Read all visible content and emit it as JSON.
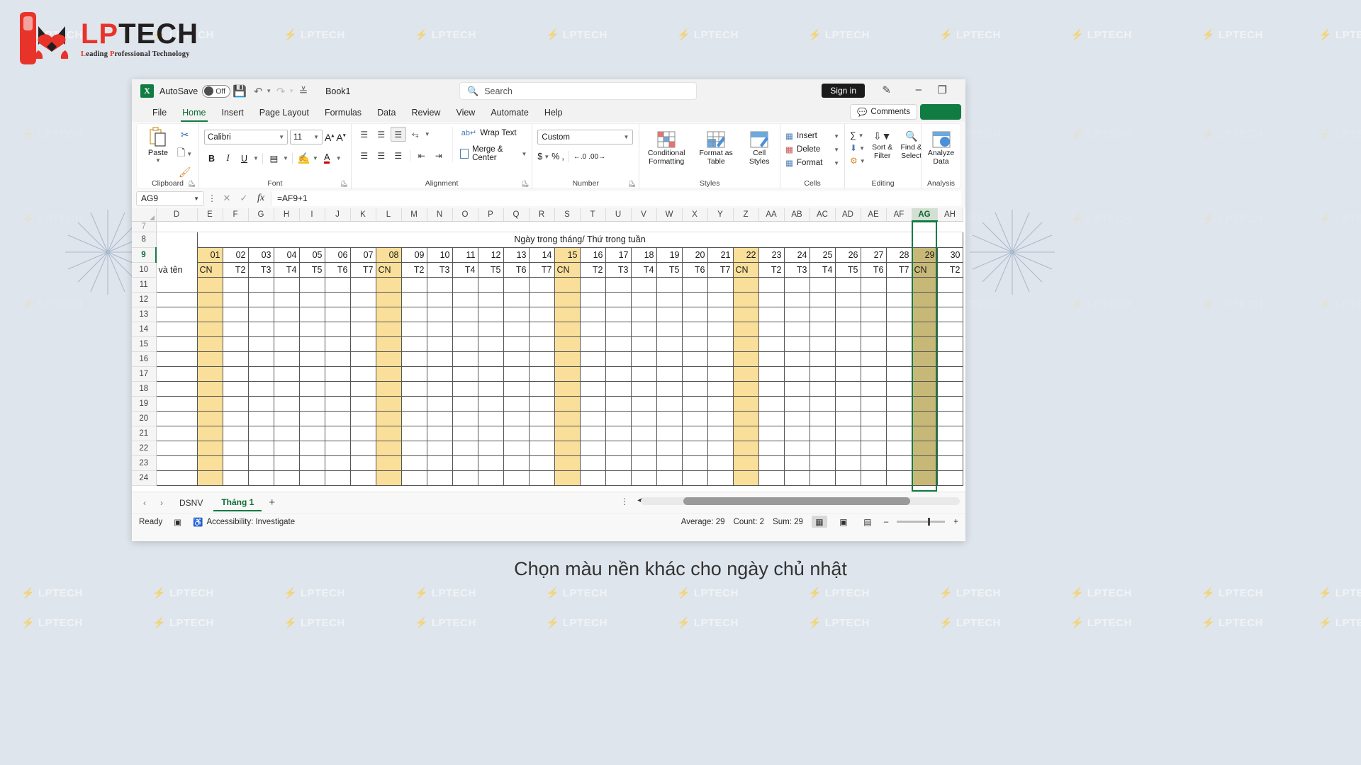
{
  "brand": {
    "name_lp": "LP",
    "name_tech": "TECH",
    "tagline_parts": [
      "L",
      "eading ",
      "P",
      "rofessional Technology"
    ],
    "watermark_text": "LPTECH",
    "accent_red": "#e8332a",
    "accent_dark": "#231f20"
  },
  "caption": "Chọn màu nền khác cho ngày chủ nhật",
  "titlebar": {
    "app_icon": "excel-icon",
    "autosave_label": "AutoSave",
    "autosave_state": "Off",
    "save_icon": "save-icon",
    "undo_icon": "undo-icon",
    "redo_icon": "redo-icon",
    "customize_icon": "customize-quick-access-icon",
    "document_title": "Book1",
    "search_placeholder": "Search",
    "search_icon": "search-icon",
    "sign_in_label": "Sign in",
    "pen_icon": "pen-icon",
    "minimize_label": "–",
    "restore_label": "❐"
  },
  "ribbon_tabs": [
    {
      "label": "File",
      "active": false
    },
    {
      "label": "Home",
      "active": true
    },
    {
      "label": "Insert",
      "active": false
    },
    {
      "label": "Page Layout",
      "active": false
    },
    {
      "label": "Formulas",
      "active": false
    },
    {
      "label": "Data",
      "active": false
    },
    {
      "label": "Review",
      "active": false
    },
    {
      "label": "View",
      "active": false
    },
    {
      "label": "Automate",
      "active": false
    },
    {
      "label": "Help",
      "active": false
    }
  ],
  "ribbon_right": {
    "comments_label": "Comments",
    "comment_icon": "comment-icon",
    "share_label": ""
  },
  "ribbon": {
    "clipboard": {
      "group_label": "Clipboard",
      "paste_label": "Paste",
      "cut_icon": "scissors-icon",
      "copy_icon": "copy-icon",
      "format_painter_icon": "format-painter-icon",
      "dialog_launcher": "dialog-launcher-icon"
    },
    "font": {
      "group_label": "Font",
      "font_name": "Calibri",
      "font_size": "11",
      "grow_font": "A",
      "shrink_font": "A",
      "bold": "B",
      "italic": "I",
      "underline": "U",
      "borders_icon": "borders-icon",
      "fill_color_icon": "fill-color-icon",
      "font_color_icon": "font-color-icon",
      "dialog_launcher": "dialog-launcher-icon"
    },
    "alignment": {
      "group_label": "Alignment",
      "wrap_text_label": "Wrap Text",
      "merge_center_label": "Merge & Center",
      "align_top_icon": "align-top-icon",
      "align_middle_icon": "align-middle-icon",
      "align_bottom_icon": "align-bottom-icon",
      "orientation_icon": "orientation-icon",
      "align_left_icon": "align-left-icon",
      "align_center_icon": "align-center-icon",
      "align_right_icon": "align-right-icon",
      "decrease_indent_icon": "decrease-indent-icon",
      "increase_indent_icon": "increase-indent-icon",
      "dialog_launcher": "dialog-launcher-icon"
    },
    "number": {
      "group_label": "Number",
      "format_value": "Custom",
      "currency": "$",
      "percent": "%",
      "comma": ",",
      "increase_decimal": ".00",
      "decrease_decimal": ".0",
      "dialog_launcher": "dialog-launcher-icon"
    },
    "styles": {
      "group_label": "Styles",
      "conditional_formatting": "Conditional Formatting",
      "format_as_table": "Format as Table",
      "cell_styles": "Cell Styles"
    },
    "cells": {
      "group_label": "Cells",
      "insert_label": "Insert",
      "delete_label": "Delete",
      "format_label": "Format"
    },
    "editing": {
      "group_label": "Editing",
      "autosum_icon": "autosum-icon",
      "fill_icon": "fill-down-icon",
      "clear_icon": "clear-icon",
      "sort_filter_label": "Sort & Filter",
      "find_select_label": "Find & Select"
    },
    "analysis": {
      "group_label": "Analysis",
      "analyze_data_label": "Analyze Data"
    }
  },
  "formula_bar": {
    "name_box": "AG9",
    "cancel_icon": "cancel-icon",
    "enter_icon": "enter-icon",
    "fx_icon": "insert-function-icon",
    "formula": "=AF9+1"
  },
  "sheet": {
    "columns": [
      "D",
      "E",
      "F",
      "G",
      "H",
      "I",
      "J",
      "K",
      "L",
      "M",
      "N",
      "O",
      "P",
      "Q",
      "R",
      "S",
      "T",
      "U",
      "V",
      "W",
      "X",
      "Y",
      "Z",
      "AA",
      "AB",
      "AC",
      "AD",
      "AE",
      "AF",
      "AG",
      "AH"
    ],
    "selected_column": "AG",
    "rows": [
      7,
      8,
      9,
      10,
      11,
      12,
      13,
      14,
      15,
      16,
      17,
      18,
      19,
      20,
      21,
      22,
      23,
      24
    ],
    "selected_row": 9,
    "merged_title": "Ngày trong tháng/ Thứ trong tuần",
    "label_cell": "và tên",
    "day_numbers": [
      "01",
      "02",
      "03",
      "04",
      "05",
      "06",
      "07",
      "08",
      "09",
      "10",
      "11",
      "12",
      "13",
      "14",
      "15",
      "16",
      "17",
      "18",
      "19",
      "20",
      "21",
      "22",
      "23",
      "24",
      "25",
      "26",
      "27",
      "28",
      "29",
      "30"
    ],
    "weekdays": [
      "CN",
      "T2",
      "T3",
      "T4",
      "T5",
      "T6",
      "T7",
      "CN",
      "T2",
      "T3",
      "T4",
      "T5",
      "T6",
      "T7",
      "CN",
      "T2",
      "T3",
      "T4",
      "T5",
      "T6",
      "T7",
      "CN",
      "T2",
      "T3",
      "T4",
      "T5",
      "T6",
      "T7",
      "CN",
      "T2"
    ],
    "sunday_indices": [
      0,
      7,
      14,
      21,
      28
    ],
    "sunday_fill": "#fadf9a",
    "selection_fill": "#c8b878",
    "selection_border": "#107c41"
  },
  "sheet_tabs": {
    "prev_icon": "prev-sheet-icon",
    "next_icon": "next-sheet-icon",
    "tabs": [
      {
        "label": "DSNV",
        "active": false
      },
      {
        "label": "Tháng 1",
        "active": true
      }
    ],
    "add_sheet_icon": "add-sheet-icon"
  },
  "status_bar": {
    "ready_label": "Ready",
    "recording_icon": "macro-record-icon",
    "accessibility_label": "Accessibility: Investigate",
    "average_label": "Average: 29",
    "count_label": "Count: 2",
    "sum_label": "Sum: 29",
    "view_normal_icon": "normal-view-icon",
    "view_pagelayout_icon": "page-layout-view-icon",
    "view_pagebreak_icon": "page-break-view-icon",
    "zoom_out": "–",
    "zoom_in": "+"
  }
}
